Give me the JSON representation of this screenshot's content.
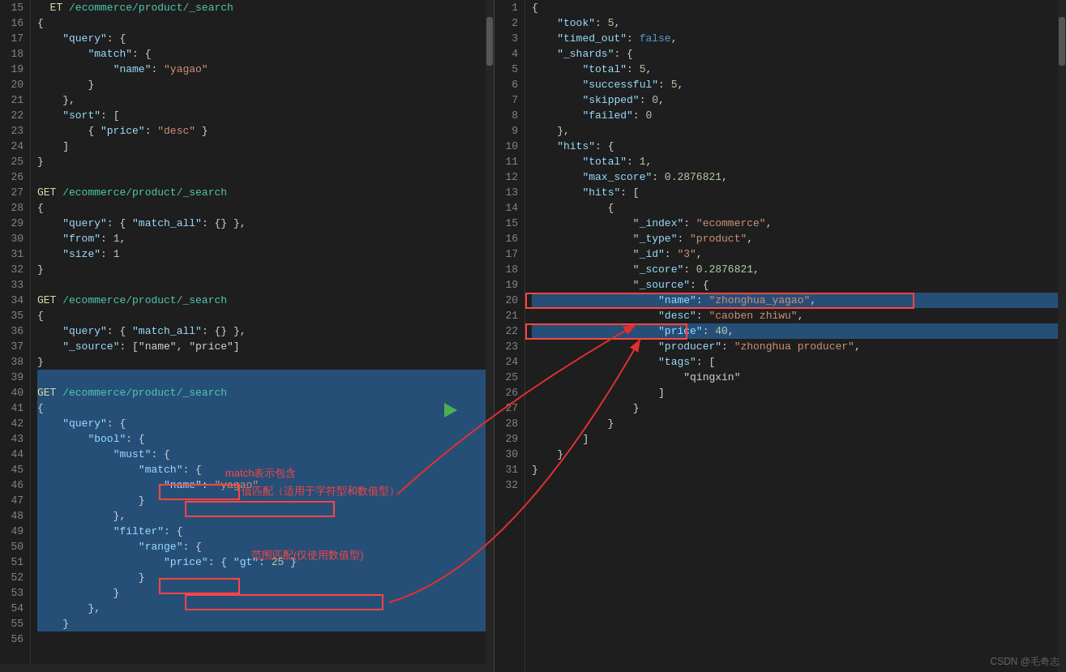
{
  "left": {
    "lines": [
      {
        "n": 15,
        "text": "  ET /ecommerce/product/_search",
        "type": "get_comment"
      },
      {
        "n": 16,
        "text": "{",
        "type": "punct"
      },
      {
        "n": 17,
        "text": "    \"query\" : {",
        "type": "normal"
      },
      {
        "n": 18,
        "text": "        \"match\" : {",
        "type": "normal"
      },
      {
        "n": 19,
        "text": "            \"name\" : \"yagao\"",
        "type": "normal"
      },
      {
        "n": 20,
        "text": "        }",
        "type": "normal"
      },
      {
        "n": 21,
        "text": "    },",
        "type": "normal"
      },
      {
        "n": 22,
        "text": "    \"sort\": [",
        "type": "normal"
      },
      {
        "n": 23,
        "text": "        { \"price\": \"desc\" }",
        "type": "normal"
      },
      {
        "n": 24,
        "text": "    ]",
        "type": "normal"
      },
      {
        "n": 25,
        "text": "}",
        "type": "normal"
      },
      {
        "n": 26,
        "text": "",
        "type": "blank"
      },
      {
        "n": 27,
        "text": "GET /ecommerce/product/_search",
        "type": "get"
      },
      {
        "n": 28,
        "text": "{",
        "type": "punct"
      },
      {
        "n": 29,
        "text": "    \"query\": { \"match_all\": {} },",
        "type": "normal"
      },
      {
        "n": 30,
        "text": "    \"from\": 1,",
        "type": "normal"
      },
      {
        "n": 31,
        "text": "    \"size\": 1",
        "type": "normal"
      },
      {
        "n": 32,
        "text": "}",
        "type": "normal"
      },
      {
        "n": 33,
        "text": "",
        "type": "blank"
      },
      {
        "n": 34,
        "text": "GET /ecommerce/product/_search",
        "type": "get"
      },
      {
        "n": 35,
        "text": "{",
        "type": "punct"
      },
      {
        "n": 36,
        "text": "    \"query\": { \"match_all\": {} },",
        "type": "normal"
      },
      {
        "n": 37,
        "text": "    \"_source\": [\"name\", \"price\"]",
        "type": "normal"
      },
      {
        "n": 38,
        "text": "}",
        "type": "normal"
      },
      {
        "n": 39,
        "text": "",
        "type": "blank"
      },
      {
        "n": 40,
        "text": "GET /ecommerce/product/_search",
        "type": "get"
      },
      {
        "n": 41,
        "text": "{",
        "type": "punct"
      },
      {
        "n": 42,
        "text": "    \"query\" : {",
        "type": "normal"
      },
      {
        "n": 43,
        "text": "        \"bool\" : {",
        "type": "normal"
      },
      {
        "n": 44,
        "text": "            \"must\" : {",
        "type": "normal"
      },
      {
        "n": 45,
        "text": "                \"match\" : {",
        "type": "normal"
      },
      {
        "n": 46,
        "text": "                    \"name\" : \"yagao\"",
        "type": "normal"
      },
      {
        "n": 47,
        "text": "                }",
        "type": "normal"
      },
      {
        "n": 48,
        "text": "            },",
        "type": "normal"
      },
      {
        "n": 49,
        "text": "            \"filter\" : {",
        "type": "normal"
      },
      {
        "n": 50,
        "text": "                \"range\" : {",
        "type": "normal"
      },
      {
        "n": 51,
        "text": "                    \"price\" : { \"gt\" : 25 }",
        "type": "normal"
      },
      {
        "n": 52,
        "text": "                }",
        "type": "normal"
      },
      {
        "n": 53,
        "text": "            }",
        "type": "normal"
      },
      {
        "n": 54,
        "text": "        },",
        "type": "normal"
      },
      {
        "n": 55,
        "text": "    }",
        "type": "normal"
      },
      {
        "n": 56,
        "text": "",
        "type": "blank"
      }
    ]
  },
  "right": {
    "lines": [
      {
        "n": 1,
        "text": "{",
        "type": "punct"
      },
      {
        "n": 2,
        "text": "    \"took\" : 5,",
        "type": "normal"
      },
      {
        "n": 3,
        "text": "    \"timed_out\" : false,",
        "type": "normal"
      },
      {
        "n": 4,
        "text": "    \"_shards\" : {",
        "type": "normal"
      },
      {
        "n": 5,
        "text": "        \"total\" : 5,",
        "type": "normal"
      },
      {
        "n": 6,
        "text": "        \"successful\" : 5,",
        "type": "normal"
      },
      {
        "n": 7,
        "text": "        \"skipped\" : 0,",
        "type": "normal"
      },
      {
        "n": 8,
        "text": "        \"failed\" : 0",
        "type": "normal"
      },
      {
        "n": 9,
        "text": "    },",
        "type": "normal"
      },
      {
        "n": 10,
        "text": "    \"hits\" : {",
        "type": "normal"
      },
      {
        "n": 11,
        "text": "        \"total\" : 1,",
        "type": "normal"
      },
      {
        "n": 12,
        "text": "        \"max_score\" : 0.2876821,",
        "type": "normal"
      },
      {
        "n": 13,
        "text": "        \"hits\" : [",
        "type": "normal"
      },
      {
        "n": 14,
        "text": "            {",
        "type": "normal"
      },
      {
        "n": 15,
        "text": "                \"_index\" : \"ecommerce\",",
        "type": "normal"
      },
      {
        "n": 16,
        "text": "                \"_type\" : \"product\",",
        "type": "normal"
      },
      {
        "n": 17,
        "text": "                \"_id\" : \"3\",",
        "type": "normal"
      },
      {
        "n": 18,
        "text": "                \"_score\" : 0.2876821,",
        "type": "normal"
      },
      {
        "n": 19,
        "text": "                \"_source\" : {",
        "type": "normal"
      },
      {
        "n": 20,
        "text": "                    \"name\" : \"zhonghua_yagao\",",
        "type": "normal",
        "highlight": true
      },
      {
        "n": 21,
        "text": "                    \"desc\" : \"caoben zhiwu\",",
        "type": "normal"
      },
      {
        "n": 22,
        "text": "                    \"price\" : 40,",
        "type": "normal",
        "highlight": true
      },
      {
        "n": 23,
        "text": "                    \"producer\" : \"zhonghua producer\",",
        "type": "normal"
      },
      {
        "n": 24,
        "text": "                    \"tags\" : [",
        "type": "normal"
      },
      {
        "n": 25,
        "text": "                        \"qingxin\"",
        "type": "normal"
      },
      {
        "n": 26,
        "text": "                    ]",
        "type": "normal"
      },
      {
        "n": 27,
        "text": "                }",
        "type": "normal"
      },
      {
        "n": 28,
        "text": "            }",
        "type": "normal"
      },
      {
        "n": 29,
        "text": "        ]",
        "type": "normal"
      },
      {
        "n": 30,
        "text": "    }",
        "type": "normal"
      },
      {
        "n": 31,
        "text": "}",
        "type": "normal"
      },
      {
        "n": 32,
        "text": "",
        "type": "blank"
      }
    ]
  },
  "annotations": {
    "match_label": "match表示包含",
    "value_match_label": "值匹配（适用于字符型和数值型）",
    "range_label": "范围匹配(仅使用数值型)"
  },
  "watermark": "CSDN @毛奇志"
}
